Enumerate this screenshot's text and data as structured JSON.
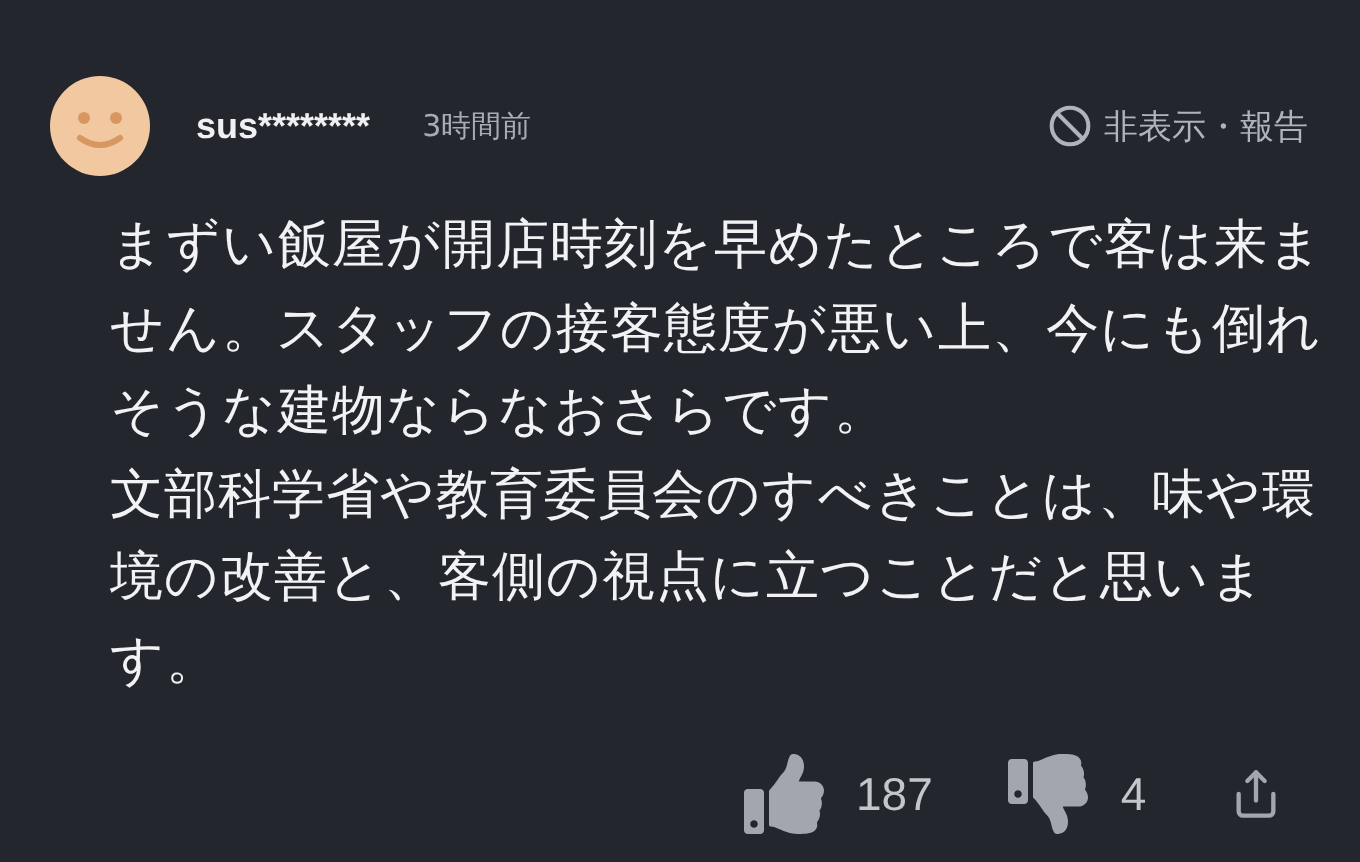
{
  "comment": {
    "user": "sus********",
    "time": "3時間前",
    "hide_report": "非表示・報告",
    "paragraphs": [
      "まずい飯屋が開店時刻を早めたところで客は来ません。スタッフの接客態度が悪い上、今にも倒れそうな建物ならなおさらです。",
      "文部科学省や教育委員会のすべきことは、味や環境の改善と、客側の視点に立つことだと思います。"
    ],
    "likes": "187",
    "dislikes": "4"
  }
}
